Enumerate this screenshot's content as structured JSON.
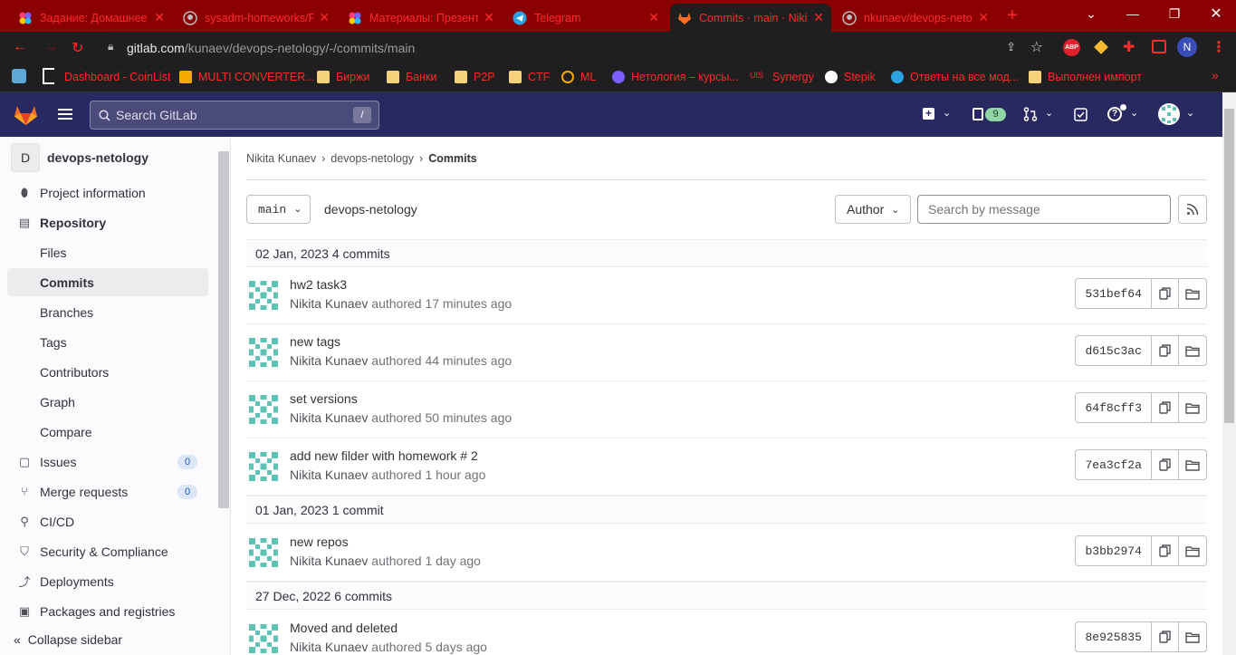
{
  "browser": {
    "tabs": [
      {
        "label": "Задание: Домашнее з",
        "icon": "netology-icon"
      },
      {
        "label": "sysadm-homeworks/R",
        "icon": "github-icon"
      },
      {
        "label": "Материалы: Презент",
        "icon": "netology-icon"
      },
      {
        "label": "Telegram",
        "icon": "telegram-icon"
      },
      {
        "label": "Commits · main · Nikit",
        "icon": "gitlab-icon"
      },
      {
        "label": "nkunaev/devops-neto",
        "icon": "github-icon"
      }
    ],
    "url_host": "gitlab.com",
    "url_path": "/kunaev/devops-netology/-/commits/main",
    "bookmarks": [
      {
        "label": "Dashboard - CoinList"
      },
      {
        "label": "MULTI CONVERTER..."
      },
      {
        "label": "Биржи"
      },
      {
        "label": "Банки"
      },
      {
        "label": "P2P"
      },
      {
        "label": "CTF"
      },
      {
        "label": "ML"
      },
      {
        "label": "Нетология – курсы..."
      },
      {
        "label": "Synergy"
      },
      {
        "label": "Stepik"
      },
      {
        "label": "Ответы на все мод..."
      },
      {
        "label": "Выполнен импорт"
      }
    ],
    "profile_letter": "N",
    "abp_label": "ABP"
  },
  "header": {
    "search_placeholder": "Search GitLab",
    "search_shortcut": "/",
    "issues_count": "9"
  },
  "sidebar": {
    "project_initial": "D",
    "project_name": "devops-netology",
    "items": [
      {
        "label": "Project information"
      },
      {
        "label": "Repository"
      },
      {
        "label": "Files"
      },
      {
        "label": "Commits"
      },
      {
        "label": "Branches"
      },
      {
        "label": "Tags"
      },
      {
        "label": "Contributors"
      },
      {
        "label": "Graph"
      },
      {
        "label": "Compare"
      },
      {
        "label": "Issues",
        "count": "0"
      },
      {
        "label": "Merge requests",
        "count": "0"
      },
      {
        "label": "CI/CD"
      },
      {
        "label": "Security & Compliance"
      },
      {
        "label": "Deployments"
      },
      {
        "label": "Packages and registries"
      }
    ],
    "collapse_label": "Collapse sidebar"
  },
  "breadcrumb": [
    "Nikita Kunaev",
    "devops-netology",
    "Commits"
  ],
  "toolbar": {
    "branch": "main",
    "project_path": "devops-netology",
    "author_label": "Author",
    "search_placeholder": "Search by message"
  },
  "commit_groups": [
    {
      "date": "02 Jan, 2023",
      "count_label": "4 commits",
      "commits": [
        {
          "title": "hw2 task3",
          "author": "Nikita Kunaev",
          "time": "authored 17 minutes ago",
          "sha": "531bef64"
        },
        {
          "title": "new tags",
          "author": "Nikita Kunaev",
          "time": "authored 44 minutes ago",
          "sha": "d615c3ac"
        },
        {
          "title": "set versions",
          "author": "Nikita Kunaev",
          "time": "authored 50 minutes ago",
          "sha": "64f8cff3"
        },
        {
          "title": "add new filder with homework # 2",
          "author": "Nikita Kunaev",
          "time": "authored 1 hour ago",
          "sha": "7ea3cf2a"
        }
      ]
    },
    {
      "date": "01 Jan, 2023",
      "count_label": "1 commit",
      "commits": [
        {
          "title": "new repos",
          "author": "Nikita Kunaev",
          "time": "authored 1 day ago",
          "sha": "b3bb2974"
        }
      ]
    },
    {
      "date": "27 Dec, 2022",
      "count_label": "6 commits",
      "commits": [
        {
          "title": "Moved and deleted",
          "author": "Nikita Kunaev",
          "time": "authored 5 days ago",
          "sha": "8e925835"
        }
      ]
    }
  ],
  "colors": {
    "tabbar": "#8b0000",
    "chrome_text": "#ff2a2a",
    "gitlab_header": "#292961",
    "avatar_teal": "#5ec3b4"
  }
}
